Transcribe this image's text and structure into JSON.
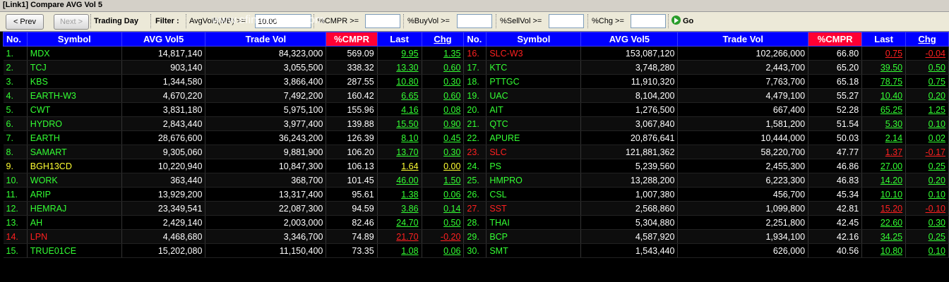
{
  "window": {
    "title": "[Link1] Compare AVG Vol 5",
    "watermark": "www.efinancethai.com"
  },
  "toolbar": {
    "prev_label": "< Prev",
    "next_label": "Next >",
    "trading_day_label": "Trading Day",
    "filter_label": "Filter :",
    "avgvol_label": "AvgVol5(MB) >=",
    "avgvol_value": "10.00",
    "cmpr_label": "%CMPR >=",
    "cmpr_value": "",
    "buyvol_label": "%BuyVol >=",
    "buyvol_value": "",
    "sellvol_label": "%SellVol >=",
    "sellvol_value": "",
    "chg_label": "%Chg >=",
    "chg_value": "",
    "go_label": "Go"
  },
  "colors": {
    "up": "#33ff33",
    "down": "#ff2020",
    "unchanged": "#ffff33",
    "header": "#0000ff",
    "highlight_header": "#ff0033"
  },
  "columns": [
    "No.",
    "Symbol",
    "AVG Vol5",
    "Trade Vol",
    "%CMPR",
    "Last",
    "Chg"
  ],
  "left_rows": [
    {
      "no": "1.",
      "symbol": "MDX",
      "avg": "14,817,140",
      "trade": "84,323,000",
      "cmpr": "569.09",
      "last": "9.95",
      "chg": "1.35",
      "dir": "up"
    },
    {
      "no": "2.",
      "symbol": "TCJ",
      "avg": "903,140",
      "trade": "3,055,500",
      "cmpr": "338.32",
      "last": "13.30",
      "chg": "0.60",
      "dir": "up"
    },
    {
      "no": "3.",
      "symbol": "KBS",
      "avg": "1,344,580",
      "trade": "3,866,400",
      "cmpr": "287.55",
      "last": "10.80",
      "chg": "0.30",
      "dir": "up"
    },
    {
      "no": "4.",
      "symbol": "EARTH-W3",
      "avg": "4,670,220",
      "trade": "7,492,200",
      "cmpr": "160.42",
      "last": "6.65",
      "chg": "0.60",
      "dir": "up"
    },
    {
      "no": "5.",
      "symbol": "CWT",
      "avg": "3,831,180",
      "trade": "5,975,100",
      "cmpr": "155.96",
      "last": "4.16",
      "chg": "0.08",
      "dir": "up"
    },
    {
      "no": "6.",
      "symbol": "HYDRO",
      "avg": "2,843,440",
      "trade": "3,977,400",
      "cmpr": "139.88",
      "last": "15.50",
      "chg": "0.90",
      "dir": "up"
    },
    {
      "no": "7.",
      "symbol": "EARTH",
      "avg": "28,676,600",
      "trade": "36,243,200",
      "cmpr": "126.39",
      "last": "8.10",
      "chg": "0.45",
      "dir": "up"
    },
    {
      "no": "8.",
      "symbol": "SAMART",
      "avg": "9,305,060",
      "trade": "9,881,900",
      "cmpr": "106.20",
      "last": "13.70",
      "chg": "0.30",
      "dir": "up"
    },
    {
      "no": "9.",
      "symbol": "BGH13CD",
      "avg": "10,220,940",
      "trade": "10,847,300",
      "cmpr": "106.13",
      "last": "1.64",
      "chg": "0.00",
      "dir": "eq"
    },
    {
      "no": "10.",
      "symbol": "WORK",
      "avg": "363,440",
      "trade": "368,700",
      "cmpr": "101.45",
      "last": "46.00",
      "chg": "1.50",
      "dir": "up"
    },
    {
      "no": "11.",
      "symbol": "ARIP",
      "avg": "13,929,200",
      "trade": "13,317,400",
      "cmpr": "95.61",
      "last": "1.38",
      "chg": "0.06",
      "dir": "up"
    },
    {
      "no": "12.",
      "symbol": "HEMRAJ",
      "avg": "23,349,541",
      "trade": "22,087,300",
      "cmpr": "94.59",
      "last": "3.86",
      "chg": "0.14",
      "dir": "up"
    },
    {
      "no": "13.",
      "symbol": "AH",
      "avg": "2,429,140",
      "trade": "2,003,000",
      "cmpr": "82.46",
      "last": "24.70",
      "chg": "0.50",
      "dir": "up"
    },
    {
      "no": "14.",
      "symbol": "LPN",
      "avg": "4,468,680",
      "trade": "3,346,700",
      "cmpr": "74.89",
      "last": "21.70",
      "chg": "-0.20",
      "dir": "dn"
    },
    {
      "no": "15.",
      "symbol": "TRUE01CE",
      "avg": "15,202,080",
      "trade": "11,150,400",
      "cmpr": "73.35",
      "last": "1.08",
      "chg": "0.06",
      "dir": "up"
    }
  ],
  "right_rows": [
    {
      "no": "16.",
      "symbol": "SLC-W3",
      "avg": "153,087,120",
      "trade": "102,266,000",
      "cmpr": "66.80",
      "last": "0.75",
      "chg": "-0.04",
      "dir": "dn"
    },
    {
      "no": "17.",
      "symbol": "KTC",
      "avg": "3,748,280",
      "trade": "2,443,700",
      "cmpr": "65.20",
      "last": "39.50",
      "chg": "0.50",
      "dir": "up"
    },
    {
      "no": "18.",
      "symbol": "PTTGC",
      "avg": "11,910,320",
      "trade": "7,763,700",
      "cmpr": "65.18",
      "last": "78.75",
      "chg": "0.75",
      "dir": "up"
    },
    {
      "no": "19.",
      "symbol": "UAC",
      "avg": "8,104,200",
      "trade": "4,479,100",
      "cmpr": "55.27",
      "last": "10.40",
      "chg": "0.20",
      "dir": "up"
    },
    {
      "no": "20.",
      "symbol": "AIT",
      "avg": "1,276,500",
      "trade": "667,400",
      "cmpr": "52.28",
      "last": "65.25",
      "chg": "1.25",
      "dir": "up"
    },
    {
      "no": "21.",
      "symbol": "QTC",
      "avg": "3,067,840",
      "trade": "1,581,200",
      "cmpr": "51.54",
      "last": "5.30",
      "chg": "0.10",
      "dir": "up"
    },
    {
      "no": "22.",
      "symbol": "APURE",
      "avg": "20,876,641",
      "trade": "10,444,000",
      "cmpr": "50.03",
      "last": "2.14",
      "chg": "0.02",
      "dir": "up"
    },
    {
      "no": "23.",
      "symbol": "SLC",
      "avg": "121,881,362",
      "trade": "58,220,700",
      "cmpr": "47.77",
      "last": "1.37",
      "chg": "-0.17",
      "dir": "dn"
    },
    {
      "no": "24.",
      "symbol": "PS",
      "avg": "5,239,560",
      "trade": "2,455,300",
      "cmpr": "46.86",
      "last": "27.00",
      "chg": "0.25",
      "dir": "up"
    },
    {
      "no": "25.",
      "symbol": "HMPRO",
      "avg": "13,288,200",
      "trade": "6,223,300",
      "cmpr": "46.83",
      "last": "14.20",
      "chg": "0.20",
      "dir": "up"
    },
    {
      "no": "26.",
      "symbol": "CSL",
      "avg": "1,007,380",
      "trade": "456,700",
      "cmpr": "45.34",
      "last": "10.10",
      "chg": "0.10",
      "dir": "up"
    },
    {
      "no": "27.",
      "symbol": "SST",
      "avg": "2,568,860",
      "trade": "1,099,800",
      "cmpr": "42.81",
      "last": "15.20",
      "chg": "-0.10",
      "dir": "dn"
    },
    {
      "no": "28.",
      "symbol": "THAI",
      "avg": "5,304,880",
      "trade": "2,251,800",
      "cmpr": "42.45",
      "last": "22.60",
      "chg": "0.30",
      "dir": "up"
    },
    {
      "no": "29.",
      "symbol": "BCP",
      "avg": "4,587,920",
      "trade": "1,934,100",
      "cmpr": "42.16",
      "last": "34.25",
      "chg": "0.25",
      "dir": "up"
    },
    {
      "no": "30.",
      "symbol": "SMT",
      "avg": "1,543,440",
      "trade": "626,000",
      "cmpr": "40.56",
      "last": "10.80",
      "chg": "0.10",
      "dir": "up"
    }
  ]
}
